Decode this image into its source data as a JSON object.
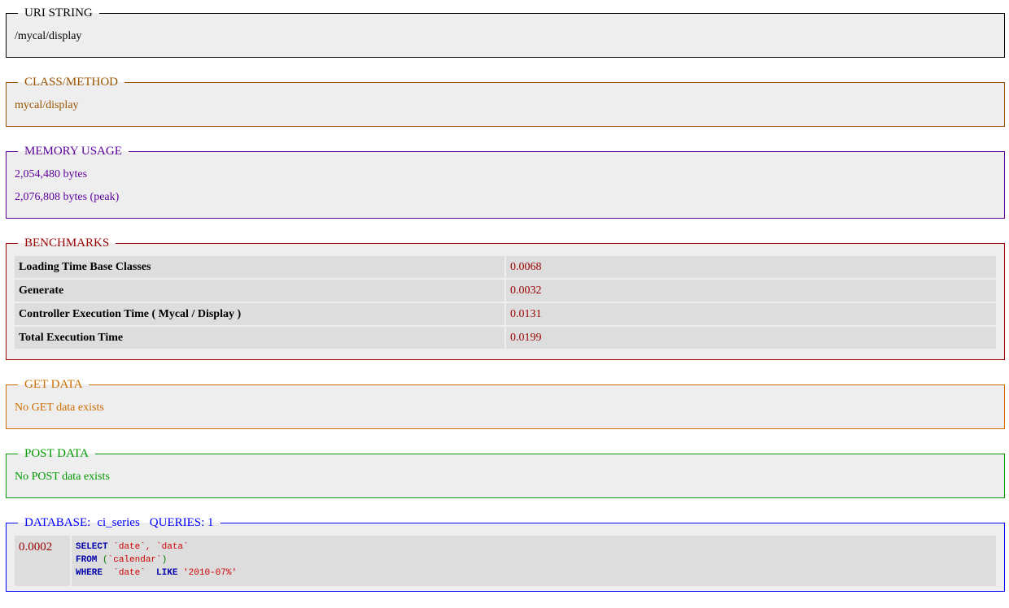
{
  "uri": {
    "legend": "URI STRING",
    "value": "/mycal/display"
  },
  "class_method": {
    "legend": "CLASS/METHOD",
    "value": "mycal/display"
  },
  "memory": {
    "legend": "MEMORY USAGE",
    "usage": "2,054,480 bytes",
    "peak": "2,076,808 bytes (peak)"
  },
  "benchmarks": {
    "legend": "BENCHMARKS",
    "rows": [
      {
        "label": "Loading Time Base Classes",
        "value": "0.0068"
      },
      {
        "label": "Generate",
        "value": "0.0032"
      },
      {
        "label": "Controller Execution Time ( Mycal / Display )",
        "value": "0.0131"
      },
      {
        "label": "Total Execution Time",
        "value": "0.0199"
      }
    ]
  },
  "get_data": {
    "legend": "GET DATA",
    "message": "No GET data exists"
  },
  "post_data": {
    "legend": "POST DATA",
    "message": "No POST data exists"
  },
  "database": {
    "label": "DATABASE:",
    "name": "ci_series",
    "queries_label": "QUERIES: 1",
    "query": {
      "time": "0.0002",
      "kw_select": "SELECT",
      "select_cols": "`date`, `data`",
      "kw_from": "FROM",
      "from_open": "(",
      "from_table": "`calendar`",
      "from_close": ")",
      "kw_where": "WHERE",
      "where_col": "`date`",
      "kw_like": "LIKE",
      "where_val": "'2010-07%'"
    }
  }
}
